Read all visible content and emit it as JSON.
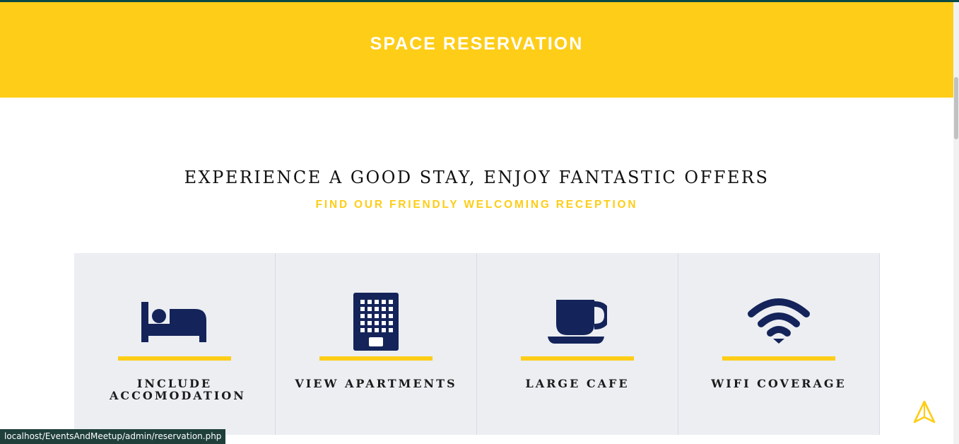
{
  "hero": {
    "title": "SPACE RESERVATION"
  },
  "intro": {
    "headline": "EXPERIENCE A GOOD STAY, ENJOY FANTASTIC OFFERS",
    "subheadline": "FIND OUR FRIENDLY WELCOMING RECEPTION"
  },
  "features": [
    {
      "icon": "bed-icon",
      "label": "INCLUDE ACCOMODATION"
    },
    {
      "icon": "building-icon",
      "label": "VIEW APARTMENTS"
    },
    {
      "icon": "coffee-cup-icon",
      "label": "LARGE CAFE"
    },
    {
      "icon": "wifi-icon",
      "label": "WIFI COVERAGE"
    }
  ],
  "status_bar": {
    "url": "localhost/EventsAndMeetup/admin/reservation.php"
  },
  "floating": {
    "icon": "navigation-arrow-icon"
  },
  "colors": {
    "accent": "#fecd17",
    "icon_navy": "#14245a",
    "panel": "#eceef2"
  }
}
